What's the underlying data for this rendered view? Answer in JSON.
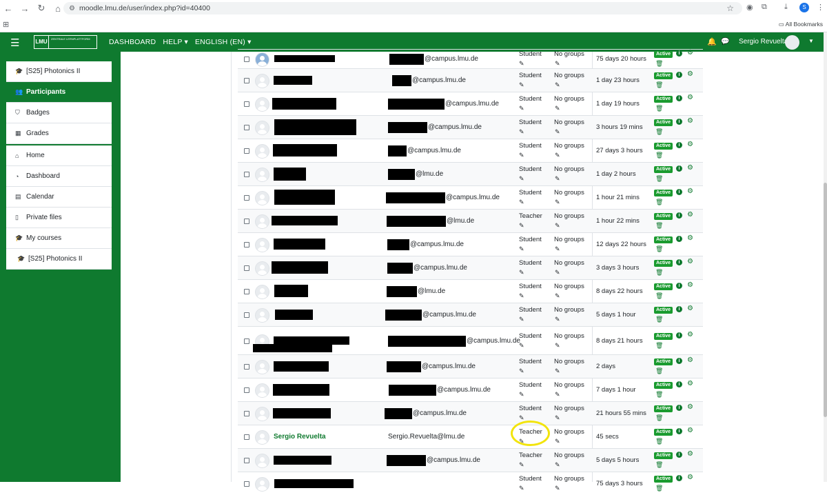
{
  "browser": {
    "url": "moodle.lmu.de/user/index.php?id=40400",
    "all_bookmarks": "All Bookmarks",
    "profile_initial": "S"
  },
  "navbar": {
    "logo_text": "LMU",
    "logo_sub": "ZENTRALE LERNPLATTFORM",
    "links": [
      "DASHBOARD",
      "HELP ▾",
      "ENGLISH (EN) ▾"
    ],
    "user_name": "Sergio Revuelta"
  },
  "drawer": {
    "course_items": [
      {
        "label": "[S25] Photonics II",
        "icon": "graduation-cap-icon",
        "glyph": "🎓"
      },
      {
        "label": "Participants",
        "icon": "users-icon",
        "glyph": "👥",
        "active": true
      },
      {
        "label": "Badges",
        "icon": "shield-icon",
        "glyph": "⛉"
      },
      {
        "label": "Grades",
        "icon": "table-icon",
        "glyph": "▦"
      }
    ],
    "site_items": [
      {
        "label": "Home",
        "icon": "home-icon",
        "glyph": "⌂"
      },
      {
        "label": "Dashboard",
        "icon": "dashboard-icon",
        "glyph": "◔"
      },
      {
        "label": "Calendar",
        "icon": "calendar-icon",
        "glyph": "▤"
      },
      {
        "label": "Private files",
        "icon": "file-icon",
        "glyph": "▯"
      },
      {
        "label": "My courses",
        "icon": "graduation-cap-icon",
        "glyph": "🎓"
      },
      {
        "label": "[S25] Photonics II",
        "icon": "graduation-cap-icon",
        "glyph": "🎓"
      }
    ]
  },
  "status_label": "Active",
  "groups_label": "No groups",
  "participants": [
    {
      "email_suffix": "@campus.lmu.de",
      "role": "Student",
      "last_access": "75 days 20 hours"
    },
    {
      "email_suffix": "@campus.lmu.de",
      "role": "Student",
      "last_access": "1 day 23 hours"
    },
    {
      "email_suffix": "@campus.lmu.de",
      "role": "Student",
      "last_access": "1 day 19 hours"
    },
    {
      "email_suffix": "@campus.lmu.de",
      "role": "Student",
      "last_access": "3 hours 19 mins"
    },
    {
      "email_suffix": "@campus.lmu.de",
      "role": "Student",
      "last_access": "27 days 3 hours"
    },
    {
      "email_suffix": "@lmu.de",
      "role": "Student",
      "last_access": "1 day 2 hours"
    },
    {
      "email_suffix": "@campus.lmu.de",
      "role": "Student",
      "last_access": "1 hour 21 mins"
    },
    {
      "email_suffix": "@lmu.de",
      "role": "Teacher",
      "last_access": "1 hour 22 mins"
    },
    {
      "email_suffix": "@campus.lmu.de",
      "role": "Student",
      "last_access": "12 days 22 hours"
    },
    {
      "email_suffix": "@campus.lmu.de",
      "role": "Student",
      "last_access": "3 days 3 hours"
    },
    {
      "email_suffix": "@lmu.de",
      "role": "Student",
      "last_access": "8 days 22 hours"
    },
    {
      "email_suffix": "@campus.lmu.de",
      "role": "Student",
      "last_access": "5 days 1 hour"
    },
    {
      "email_suffix": "@campus.lmu.de",
      "role": "Student",
      "last_access": "8 days 21 hours"
    },
    {
      "email_suffix": "@campus.lmu.de",
      "role": "Student",
      "last_access": "2 days"
    },
    {
      "email_suffix": "@campus.lmu.de",
      "role": "Student",
      "last_access": "7 days 1 hour"
    },
    {
      "email_suffix": "@campus.lmu.de",
      "role": "Student",
      "last_access": "21 hours 55 mins"
    },
    {
      "name": "Sergio Revuelta",
      "email": "Sergio.Revuelta@lmu.de",
      "role": "Teacher",
      "last_access": "45 secs"
    },
    {
      "email_suffix": "@campus.lmu.de",
      "role": "Teacher",
      "last_access": "5 days 5 hours"
    },
    {
      "email_suffix": "",
      "role": "Student",
      "last_access": "75 days 3 hours"
    }
  ]
}
